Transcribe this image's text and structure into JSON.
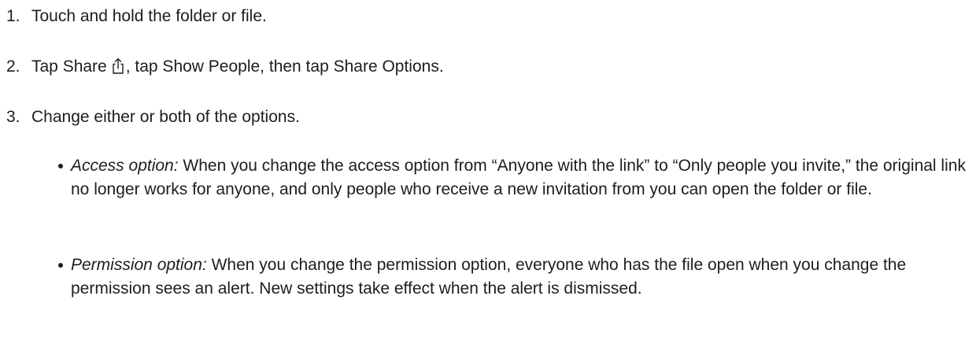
{
  "steps": [
    {
      "number": "1.",
      "text": "Touch and hold the folder or file."
    },
    {
      "number": "2.",
      "text_before_icon": "Tap Share",
      "icon": "share-icon",
      "text_after_icon": ", tap Show People, then tap Share Options."
    },
    {
      "number": "3.",
      "text": "Change either or both of the options."
    }
  ],
  "bullets": [
    {
      "term": "Access option:",
      "text": " When you change the access option from “Anyone with the link” to “Only people you invite,” the original link no longer works for anyone, and only people who receive a new invitation from you can open the folder or file."
    },
    {
      "term": "Permission option:",
      "text": " When you change the permission option, everyone who has the file open when you change the permission sees an alert. New settings take effect when the alert is dismissed."
    }
  ]
}
